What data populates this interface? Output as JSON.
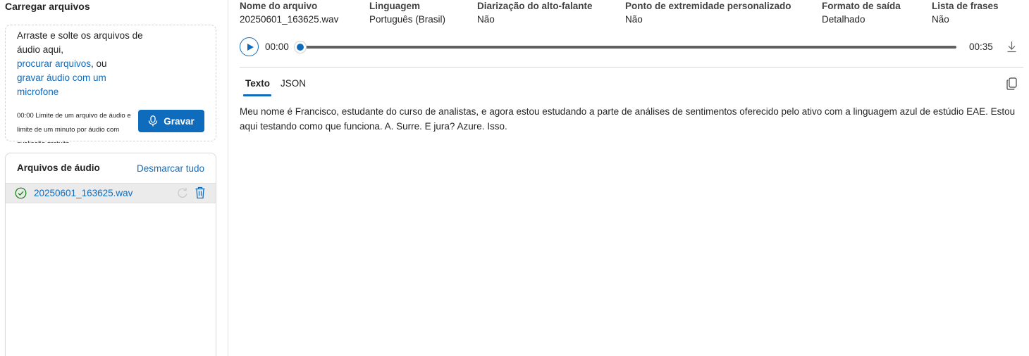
{
  "upload": {
    "title": "Carregar arquivos",
    "drop_text": "Arraste e solte os arquivos de áudio aqui,",
    "browse_link": "procurar arquivos",
    "or_text": ", ou",
    "record_link": "gravar áudio com um microfone",
    "limit_text": "00:00 Limite de um arquivo de áudio e limite de um minuto por áudio com avaliação gratuita",
    "record_button": "Gravar"
  },
  "files": {
    "title": "Arquivos de áudio",
    "deselect_all": "Desmarcar tudo",
    "items": [
      {
        "name": "20250601_163625.wav",
        "status": "check-circle-icon"
      }
    ]
  },
  "details": {
    "file_name": {
      "label": "Nome do arquivo",
      "value": "20250601_163625.wav"
    },
    "language": {
      "label": "Linguagem",
      "value": "Português (Brasil)"
    },
    "diarization": {
      "label": "Diarização do alto-falante",
      "value": "Não"
    },
    "endpoint": {
      "label": "Ponto de extremidade personalizado",
      "value": "Não"
    },
    "output_format": {
      "label": "Formato de saída",
      "value": "Detalhado"
    },
    "phrase_list": {
      "label": "Lista de frases",
      "value": "Não"
    }
  },
  "player": {
    "current_time": "00:00",
    "total_time": "00:35",
    "progress": 0
  },
  "tabs": [
    {
      "label": "Texto",
      "active": true
    },
    {
      "label": "JSON",
      "active": false
    }
  ],
  "transcript": "Meu nome é Francisco, estudante do curso de analistas, e agora estou estudando a parte de análises de sentimentos oferecido pelo ativo com a linguagem azul de estúdio EAE. Estou aqui testando como que funciona. A. Surre. E jura? Azure. Isso.",
  "colors": {
    "accent": "#0f6cbd",
    "success": "#107c10",
    "selected_row": "#ebebeb"
  }
}
